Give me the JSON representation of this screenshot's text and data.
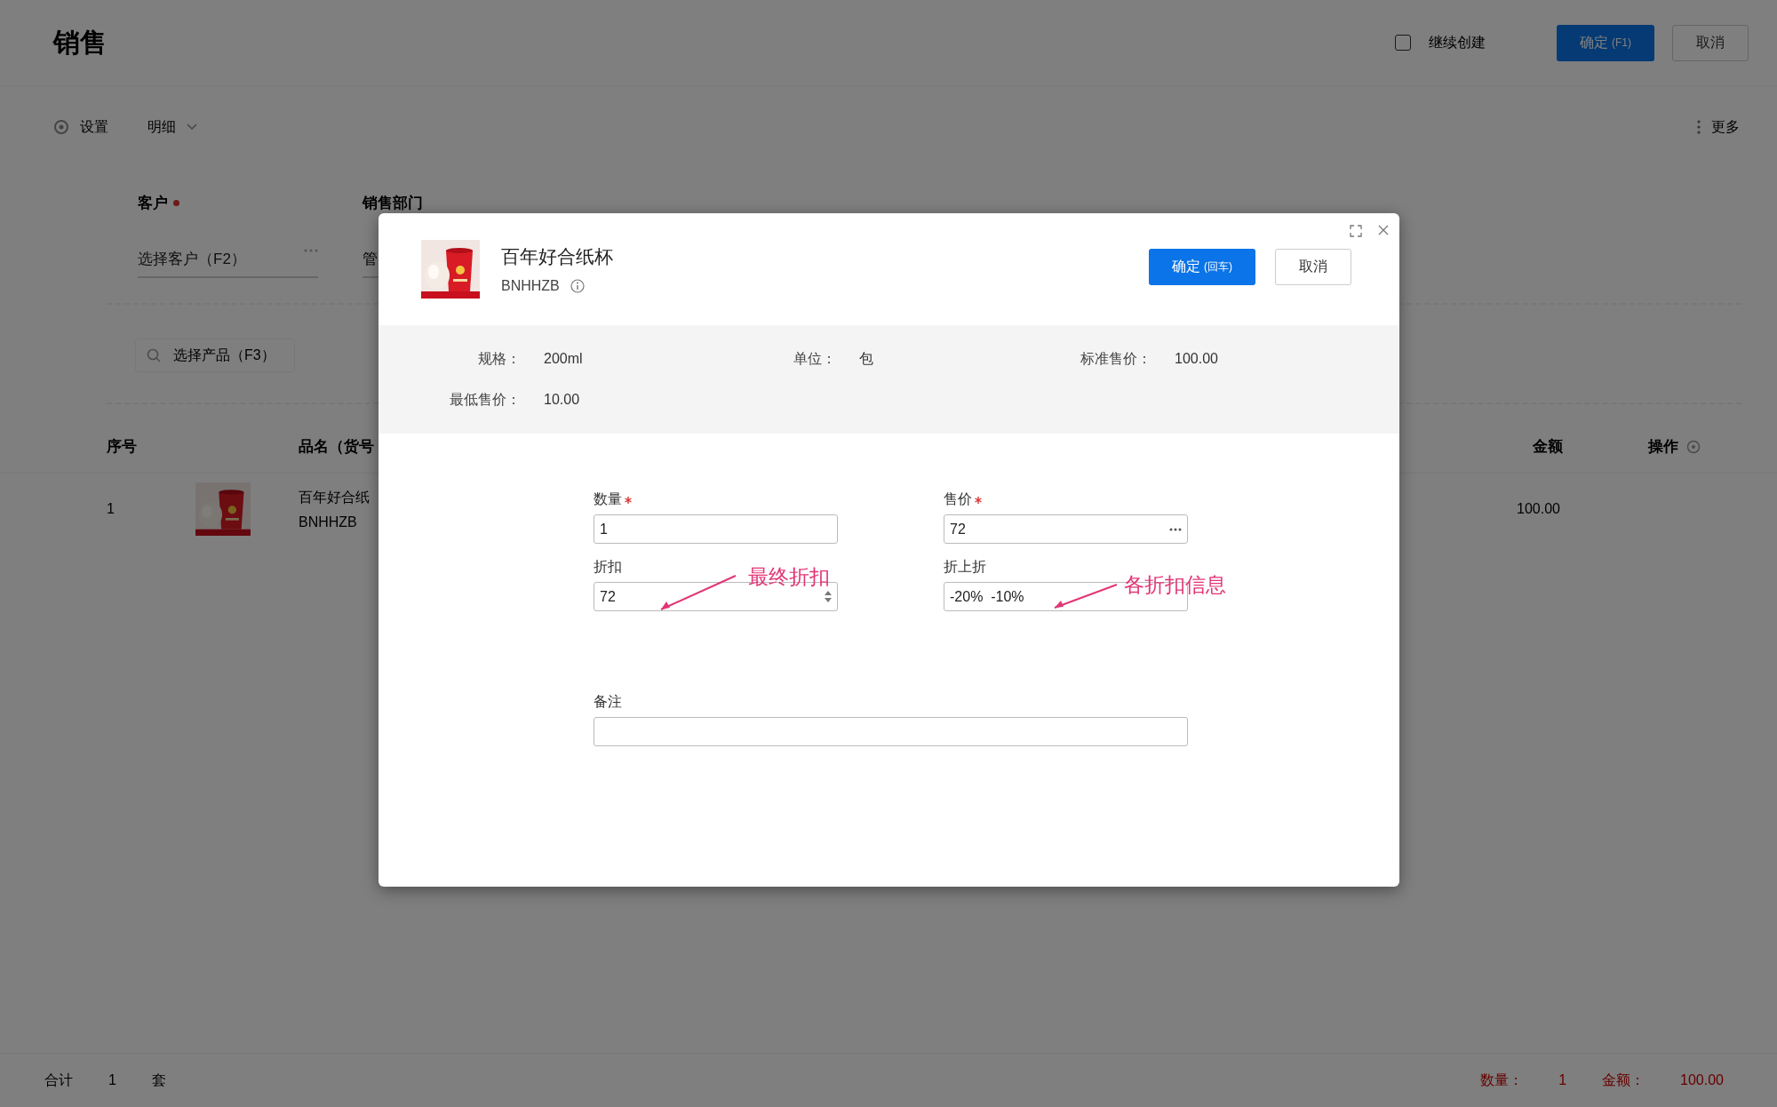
{
  "page": {
    "title": "销售",
    "continue_create": {
      "label": "继续创建",
      "checked": false
    },
    "confirm_button": "确定",
    "confirm_hint": "(F1)",
    "cancel_button": "取消"
  },
  "toolbar": {
    "settings": "设置",
    "detail": "明细",
    "more": "更多"
  },
  "form_fields": [
    {
      "label": "客户",
      "required": true,
      "placeholder": "选择客户（F2）"
    },
    {
      "label": "销售部门",
      "value": "管"
    }
  ],
  "product_search": {
    "placeholder": "选择产品（F3）"
  },
  "table": {
    "columns": [
      "序号",
      "品名（货号",
      "金额",
      "操作"
    ],
    "rows": [
      {
        "index": "1",
        "name": "百年好合纸",
        "code": "BNHHZB",
        "amount": "100.00"
      }
    ]
  },
  "footer": {
    "total_label": "合计",
    "total_count": "1",
    "unit": "套",
    "quantity_label": "数量：",
    "quantity": "1",
    "amount_label": "金额：",
    "amount": "100.00"
  },
  "modal": {
    "product": {
      "name": "百年好合纸杯",
      "code": "BNHHZB"
    },
    "confirm_button": "确定",
    "confirm_hint": "(回车)",
    "cancel_button": "取消",
    "specs": [
      {
        "label": "规格：",
        "value": "200ml"
      },
      {
        "label": "单位：",
        "value": "包"
      },
      {
        "label": "标准售价：",
        "value": "100.00"
      },
      {
        "label": "最低售价：",
        "value": "10.00"
      }
    ],
    "fields": [
      {
        "label": "数量",
        "required": true,
        "value": "1",
        "kind": "text"
      },
      {
        "label": "售价",
        "required": true,
        "value": "72",
        "kind": "picker"
      },
      {
        "label": "折扣",
        "required": false,
        "value": "72",
        "kind": "number"
      },
      {
        "label": "折上折",
        "required": false,
        "value": "-20%  -10%",
        "kind": "text"
      },
      {
        "label": "备注",
        "required": false,
        "kind": "wide"
      }
    ],
    "annotations": [
      {
        "text": "最终折扣"
      },
      {
        "text": "各折扣信息"
      }
    ]
  }
}
